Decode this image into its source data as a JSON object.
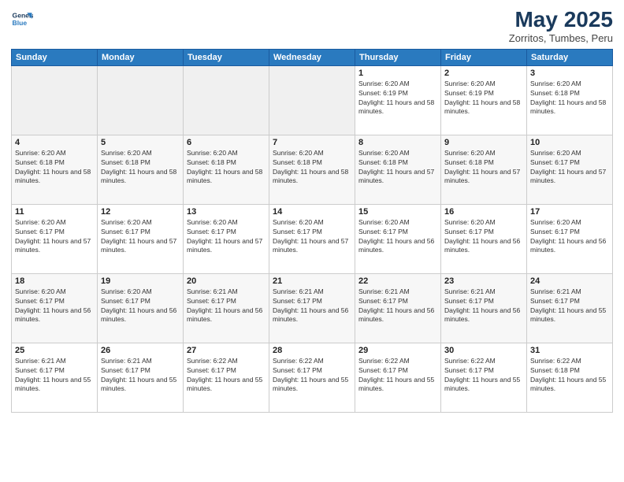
{
  "logo": {
    "line1": "General",
    "line2": "Blue"
  },
  "title": "May 2025",
  "subtitle": "Zorritos, Tumbes, Peru",
  "days_header": [
    "Sunday",
    "Monday",
    "Tuesday",
    "Wednesday",
    "Thursday",
    "Friday",
    "Saturday"
  ],
  "weeks": [
    [
      {
        "day": "",
        "empty": true
      },
      {
        "day": "",
        "empty": true
      },
      {
        "day": "",
        "empty": true
      },
      {
        "day": "",
        "empty": true
      },
      {
        "day": "1",
        "sunrise": "6:20 AM",
        "sunset": "6:19 PM",
        "daylight": "11 hours and 58 minutes."
      },
      {
        "day": "2",
        "sunrise": "6:20 AM",
        "sunset": "6:19 PM",
        "daylight": "11 hours and 58 minutes."
      },
      {
        "day": "3",
        "sunrise": "6:20 AM",
        "sunset": "6:18 PM",
        "daylight": "11 hours and 58 minutes."
      }
    ],
    [
      {
        "day": "4",
        "sunrise": "6:20 AM",
        "sunset": "6:18 PM",
        "daylight": "11 hours and 58 minutes."
      },
      {
        "day": "5",
        "sunrise": "6:20 AM",
        "sunset": "6:18 PM",
        "daylight": "11 hours and 58 minutes."
      },
      {
        "day": "6",
        "sunrise": "6:20 AM",
        "sunset": "6:18 PM",
        "daylight": "11 hours and 58 minutes."
      },
      {
        "day": "7",
        "sunrise": "6:20 AM",
        "sunset": "6:18 PM",
        "daylight": "11 hours and 58 minutes."
      },
      {
        "day": "8",
        "sunrise": "6:20 AM",
        "sunset": "6:18 PM",
        "daylight": "11 hours and 57 minutes."
      },
      {
        "day": "9",
        "sunrise": "6:20 AM",
        "sunset": "6:18 PM",
        "daylight": "11 hours and 57 minutes."
      },
      {
        "day": "10",
        "sunrise": "6:20 AM",
        "sunset": "6:17 PM",
        "daylight": "11 hours and 57 minutes."
      }
    ],
    [
      {
        "day": "11",
        "sunrise": "6:20 AM",
        "sunset": "6:17 PM",
        "daylight": "11 hours and 57 minutes."
      },
      {
        "day": "12",
        "sunrise": "6:20 AM",
        "sunset": "6:17 PM",
        "daylight": "11 hours and 57 minutes."
      },
      {
        "day": "13",
        "sunrise": "6:20 AM",
        "sunset": "6:17 PM",
        "daylight": "11 hours and 57 minutes."
      },
      {
        "day": "14",
        "sunrise": "6:20 AM",
        "sunset": "6:17 PM",
        "daylight": "11 hours and 57 minutes."
      },
      {
        "day": "15",
        "sunrise": "6:20 AM",
        "sunset": "6:17 PM",
        "daylight": "11 hours and 56 minutes."
      },
      {
        "day": "16",
        "sunrise": "6:20 AM",
        "sunset": "6:17 PM",
        "daylight": "11 hours and 56 minutes."
      },
      {
        "day": "17",
        "sunrise": "6:20 AM",
        "sunset": "6:17 PM",
        "daylight": "11 hours and 56 minutes."
      }
    ],
    [
      {
        "day": "18",
        "sunrise": "6:20 AM",
        "sunset": "6:17 PM",
        "daylight": "11 hours and 56 minutes."
      },
      {
        "day": "19",
        "sunrise": "6:20 AM",
        "sunset": "6:17 PM",
        "daylight": "11 hours and 56 minutes."
      },
      {
        "day": "20",
        "sunrise": "6:21 AM",
        "sunset": "6:17 PM",
        "daylight": "11 hours and 56 minutes."
      },
      {
        "day": "21",
        "sunrise": "6:21 AM",
        "sunset": "6:17 PM",
        "daylight": "11 hours and 56 minutes."
      },
      {
        "day": "22",
        "sunrise": "6:21 AM",
        "sunset": "6:17 PM",
        "daylight": "11 hours and 56 minutes."
      },
      {
        "day": "23",
        "sunrise": "6:21 AM",
        "sunset": "6:17 PM",
        "daylight": "11 hours and 56 minutes."
      },
      {
        "day": "24",
        "sunrise": "6:21 AM",
        "sunset": "6:17 PM",
        "daylight": "11 hours and 55 minutes."
      }
    ],
    [
      {
        "day": "25",
        "sunrise": "6:21 AM",
        "sunset": "6:17 PM",
        "daylight": "11 hours and 55 minutes."
      },
      {
        "day": "26",
        "sunrise": "6:21 AM",
        "sunset": "6:17 PM",
        "daylight": "11 hours and 55 minutes."
      },
      {
        "day": "27",
        "sunrise": "6:22 AM",
        "sunset": "6:17 PM",
        "daylight": "11 hours and 55 minutes."
      },
      {
        "day": "28",
        "sunrise": "6:22 AM",
        "sunset": "6:17 PM",
        "daylight": "11 hours and 55 minutes."
      },
      {
        "day": "29",
        "sunrise": "6:22 AM",
        "sunset": "6:17 PM",
        "daylight": "11 hours and 55 minutes."
      },
      {
        "day": "30",
        "sunrise": "6:22 AM",
        "sunset": "6:17 PM",
        "daylight": "11 hours and 55 minutes."
      },
      {
        "day": "31",
        "sunrise": "6:22 AM",
        "sunset": "6:18 PM",
        "daylight": "11 hours and 55 minutes."
      }
    ]
  ],
  "row_classes": [
    "row-odd",
    "row-even",
    "row-odd",
    "row-even",
    "row-odd"
  ],
  "labels": {
    "sunrise_prefix": "Sunrise: ",
    "sunset_prefix": "Sunset: ",
    "daylight_prefix": "Daylight: "
  }
}
